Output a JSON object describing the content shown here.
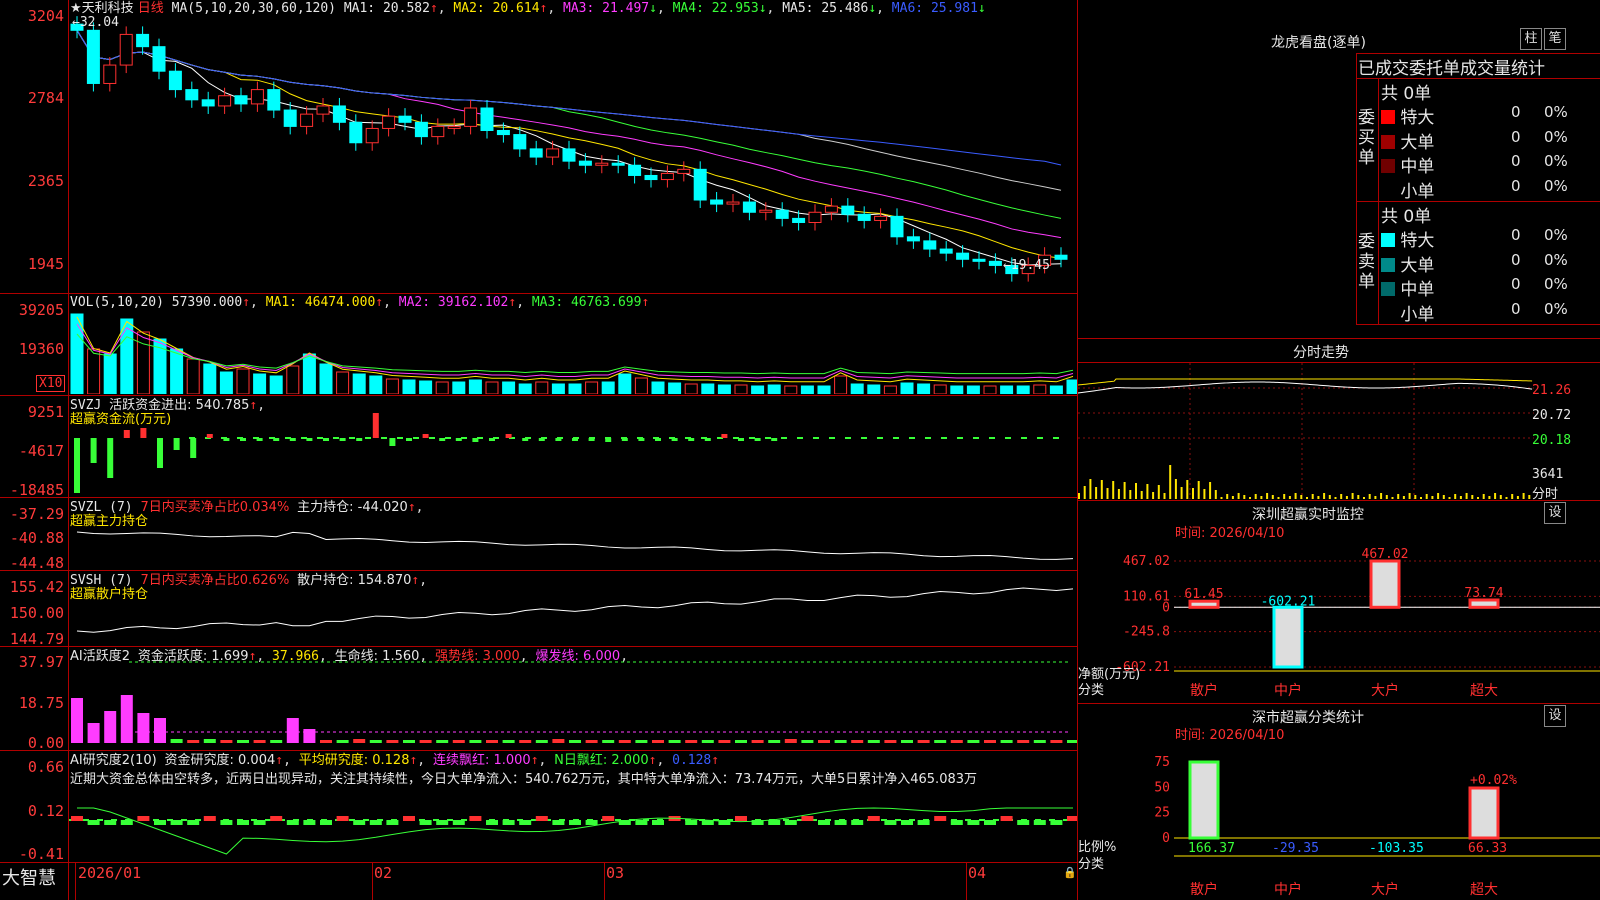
{
  "chart_data": [
    {
      "type": "candlestick",
      "title": "天利科技 日线",
      "indicators_text": "MA(5,10,20,30,60,120)",
      "y_ticks": [
        "3204",
        "2784",
        "2365",
        "1945"
      ],
      "annotations": {
        "high": "32.04",
        "low": "19.45"
      },
      "ma_values": {
        "ma1": "20.582",
        "ma2": "20.614",
        "ma3": "21.497",
        "ma4": "22.953",
        "ma5": "25.486",
        "ma6": "25.981"
      },
      "series": [
        {
          "name": "K",
          "values": [
            31.8,
            29.2,
            30.1,
            31.6,
            31.0,
            29.8,
            28.9,
            28.4,
            28.1,
            28.6,
            28.2,
            28.9,
            27.9,
            27.1,
            27.7,
            28.1,
            27.3,
            26.3,
            27.0,
            27.6,
            27.3,
            26.6,
            27.1,
            27.1,
            28.0,
            26.9,
            26.7,
            26.0,
            25.6,
            26.0,
            25.4,
            25.2,
            25.3,
            25.2,
            24.7,
            24.5,
            24.8,
            25.0,
            23.5,
            23.3,
            23.4,
            22.9,
            23.0,
            22.6,
            22.4,
            22.9,
            23.2,
            22.8,
            22.5,
            22.7,
            21.7,
            21.5,
            21.1,
            20.9,
            20.6,
            20.5,
            20.3,
            19.9,
            20.3,
            20.8,
            20.6
          ]
        }
      ]
    },
    {
      "type": "bar",
      "title": "VOL(5,10,20)",
      "y_ticks": [
        "39205",
        "19360",
        "X10"
      ],
      "values_text": {
        "vol": "57390.000",
        "ma1": "46474.000",
        "ma2": "39162.102",
        "ma3": "46763.699"
      }
    },
    {
      "type": "bar",
      "title": "SVZJ",
      "label": "活跃资金进出: 540.785",
      "sub": "超赢资金流(万元)",
      "y_ticks": [
        "9251",
        "-4617",
        "-18485"
      ]
    },
    {
      "type": "line",
      "title": "SVZL (7)",
      "label1": "7日内买卖净占比0.034%",
      "label2": "主力持仓: -44.020",
      "sub": "超赢主力持仓",
      "y_ticks": [
        "-37.29",
        "-40.88",
        "-44.48"
      ]
    },
    {
      "type": "line",
      "title": "SVSH (7)",
      "label1": "7日内买卖净占比0.626%",
      "label2": "散户持仓: 154.870",
      "sub": "超赢散户持仓",
      "y_ticks": [
        "155.42",
        "150.00",
        "144.79"
      ]
    },
    {
      "type": "bar",
      "title": "AI活跃度2",
      "text": [
        "资金活跃度: 1.699",
        "37.966",
        "生命线: 1.560",
        "强势线: 3.000",
        "爆发线: 6.000"
      ],
      "y_ticks": [
        "37.97",
        "18.75",
        "0.00"
      ]
    },
    {
      "type": "bar",
      "title": "AI研究度2(10)",
      "text": [
        "资金研究度: 0.004",
        "平均研究度: 0.128",
        "连续飘红: 1.000",
        "N日飘红: 2.000",
        "0.128"
      ],
      "comment": "近期大资金总体由空转多，近两日出现异动，关注其持续性，今日大单净流入：540.762万元，其中特大单净流入：73.74万元，大单5日累计净入465.083万",
      "y_ticks": [
        "0.66",
        "0.12",
        "-0.41"
      ]
    }
  ],
  "x_axis": {
    "labels": [
      "2026/01",
      "02",
      "03",
      "04"
    ]
  },
  "brand": "大智慧",
  "right": {
    "dragon": {
      "title": "龙虎看盘(逐单)",
      "btn1": "柱",
      "btn2": "笔",
      "subtitle": "已成交委托单成交量统计",
      "buy_label": "委买单",
      "sell_label": "委卖单",
      "buy_total": "共 0单",
      "sell_total": "共 0单",
      "buy_rows": [
        {
          "name": "特大",
          "count": "0",
          "pct": "0%",
          "color": "#ff0000"
        },
        {
          "name": "大单",
          "count": "0",
          "pct": "0%",
          "color": "#a00000"
        },
        {
          "name": "中单",
          "count": "0",
          "pct": "0%",
          "color": "#700000"
        },
        {
          "name": "小单",
          "count": "0",
          "pct": "0%",
          "color": "#000000"
        }
      ],
      "sell_rows": [
        {
          "name": "特大",
          "count": "0",
          "pct": "0%",
          "color": "#00ffff"
        },
        {
          "name": "大单",
          "count": "0",
          "pct": "0%",
          "color": "#008a8a"
        },
        {
          "name": "中单",
          "count": "0",
          "pct": "0%",
          "color": "#006a6a"
        },
        {
          "name": "小单",
          "count": "0",
          "pct": "0%",
          "color": "#000000"
        }
      ]
    },
    "intraday": {
      "title": "分时走势",
      "y_ticks": [
        "21.26",
        "20.72",
        "20.18"
      ],
      "vol_tick": "3641",
      "vol_unit": "分时"
    },
    "monitor": {
      "title": "深圳超赢实时监控",
      "btn": "设",
      "time": "时间: 2026/04/10",
      "y_ticks": [
        "467.02",
        "110.61",
        "0",
        "-245.8",
        "-602.21"
      ],
      "bars": [
        {
          "cat": "散户",
          "value": 61.45,
          "label": "61.45"
        },
        {
          "cat": "中户",
          "value": -602.21,
          "label": "-602.21"
        },
        {
          "cat": "大户",
          "value": 467.02,
          "label": "467.02"
        },
        {
          "cat": "超大",
          "value": 73.74,
          "label": "73.74"
        }
      ],
      "ylabel": "净额(万元)",
      "xlabel": "分类"
    },
    "classify": {
      "title": "深市超赢分类统计",
      "btn": "设",
      "time": "时间: 2026/04/10",
      "y_ticks": [
        "75",
        "50",
        "25",
        "0"
      ],
      "ann": "+0.02%",
      "cats": [
        "散户",
        "中户",
        "大户",
        "超大"
      ],
      "values": [
        "166.37",
        "-29.35",
        "-103.35",
        "66.33"
      ],
      "ylabel": "比例%",
      "xlabel": "分类"
    }
  }
}
